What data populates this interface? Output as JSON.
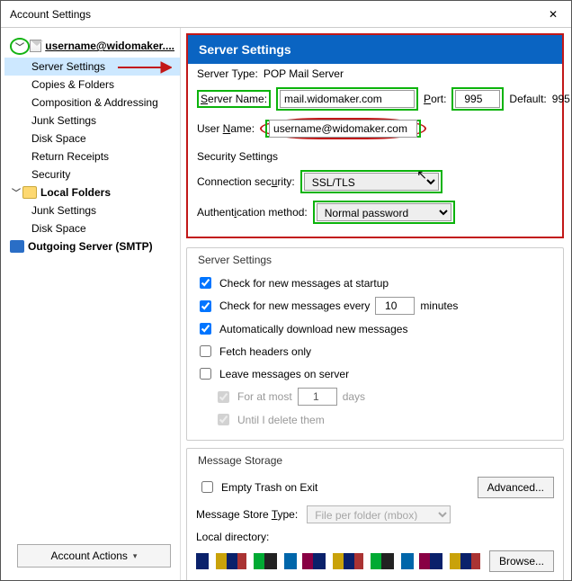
{
  "window": {
    "title": "Account Settings",
    "close": "✕"
  },
  "sidebar": {
    "account": "username@widomaker....",
    "items": [
      "Server Settings",
      "Copies & Folders",
      "Composition & Addressing",
      "Junk Settings",
      "Disk Space",
      "Return Receipts",
      "Security"
    ],
    "local": "Local Folders",
    "local_items": [
      "Junk Settings",
      "Disk Space"
    ],
    "smtp": "Outgoing Server (SMTP)",
    "actions": "Account Actions"
  },
  "hdr": "Server Settings",
  "type_lbl": "Server Type:",
  "type_val": "POP Mail Server",
  "name_lbl": "Server Name:",
  "name_val": "mail.widomaker.com",
  "port_lbl": "Port:",
  "port_val": "995",
  "default_lbl": "Default:",
  "default_val": "995",
  "user_lbl": "User Name:",
  "user_val": "username@widomaker.com",
  "sec_hdr": "Security Settings",
  "connsec_lbl": "Connection security:",
  "connsec_val": "SSL/TLS",
  "auth_lbl": "Authentication method:",
  "auth_val": "Normal password",
  "grp1": "Server Settings",
  "c1": "Check for new messages at startup",
  "c2": "Check for new messages every",
  "c2_val": "10",
  "c2_unit": "minutes",
  "c3": "Automatically download new messages",
  "c4": "Fetch headers only",
  "c5": "Leave messages on server",
  "c6": "For at most",
  "c6_val": "1",
  "c6_unit": "days",
  "c7": "Until I delete them",
  "grp2": "Message Storage",
  "s1": "Empty Trash on Exit",
  "advanced": "Advanced...",
  "store_lbl": "Message Store Type:",
  "store_val": "File per folder (mbox)",
  "local_lbl": "Local directory:",
  "browse": "Browse..."
}
